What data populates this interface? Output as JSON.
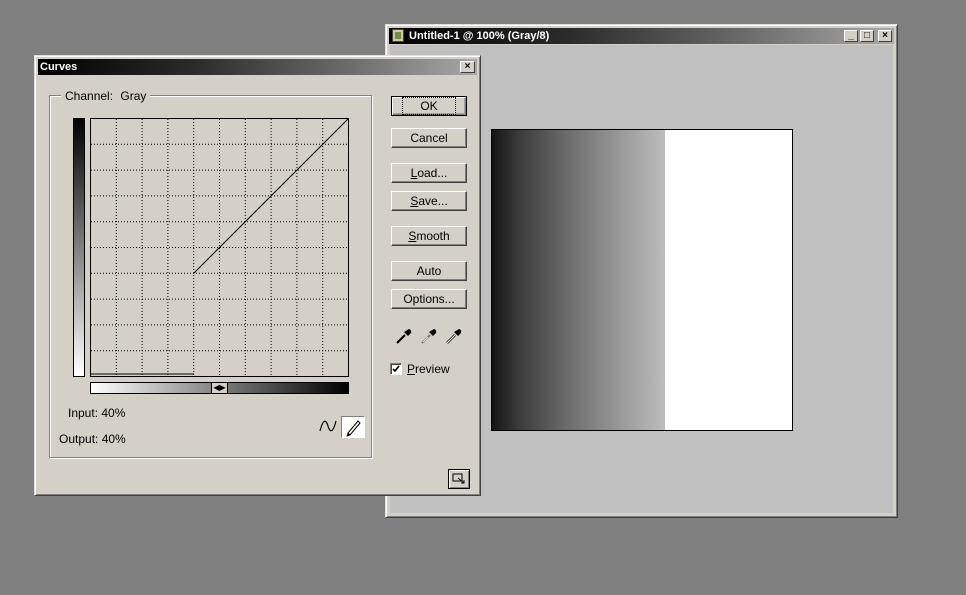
{
  "document_window": {
    "title": "Untitled-1 @ 100% (Gray/8)",
    "controls": [
      "_",
      "□",
      "×"
    ]
  },
  "curves_dialog": {
    "title": "Curves",
    "close_symbol": "×",
    "channel_label": "Channel:",
    "channel_value": "Gray",
    "buttons": {
      "ok": "OK",
      "cancel": "Cancel",
      "load_u": "L",
      "load_rest": "oad...",
      "save_u": "S",
      "save_rest": "ave...",
      "smooth_u": "S",
      "smooth_rest": "mooth",
      "auto": "Auto",
      "options": "Options..."
    },
    "preview_checked": true,
    "preview_u": "P",
    "preview_rest": "review",
    "input_label": "Input:",
    "input_value": "40%",
    "output_label": "Output:",
    "output_value": "40%",
    "curve_tool": "point-curve-icon",
    "pencil_tool": "pencil-icon",
    "eyedroppers": [
      "black-eyedropper-icon",
      "gray-eyedropper-icon",
      "white-eyedropper-icon"
    ]
  },
  "colors": {
    "desktop": "#808080",
    "window_face": "#d4d0c8",
    "canvas_bg": "#c0c0c0",
    "image_white": "#ffffff",
    "gradient_dark": "#1a1a1a",
    "gradient_light": "#bebebe"
  }
}
